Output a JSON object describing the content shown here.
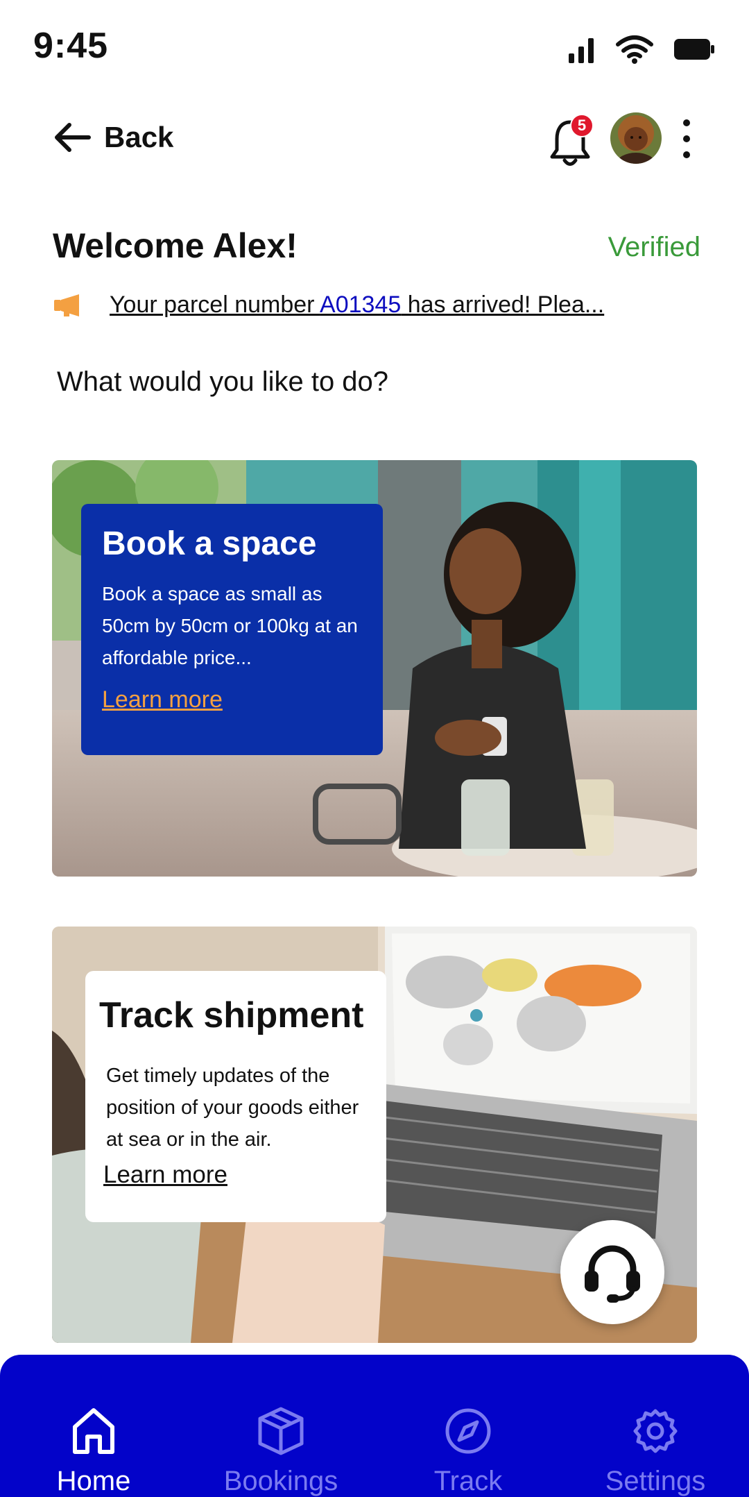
{
  "status_bar": {
    "time": "9:45"
  },
  "header": {
    "back_label": "Back",
    "notification_count": "5"
  },
  "welcome": {
    "greeting": "Welcome Alex!",
    "verified_label": "Verified"
  },
  "announcement": {
    "text_before": "Your parcel number ",
    "parcel_number": "A01345",
    "text_after": " has arrived! Plea..."
  },
  "prompt": "What would you like to do?",
  "cards": {
    "book": {
      "title": "Book a space",
      "description": "Book a space as small as 50cm by 50cm or 100kg at an affordable price...",
      "link": "Learn more"
    },
    "track": {
      "title": "Track shipment",
      "description": "Get timely updates of the position of your goods either at sea or in the air.",
      "link": "Learn more"
    }
  },
  "bottom_nav": {
    "items": [
      {
        "label": "Home",
        "icon": "home-icon",
        "active": true
      },
      {
        "label": "Bookings",
        "icon": "box-icon",
        "active": false
      },
      {
        "label": "Track",
        "icon": "compass-icon",
        "active": false
      },
      {
        "label": "Settings",
        "icon": "gear-icon",
        "active": false
      }
    ]
  },
  "colors": {
    "brand_blue": "#0303c9",
    "card_blue": "#0a2fa8",
    "accent_orange": "#f4a041",
    "verified_green": "#3a9a3a",
    "badge_red": "#e0182d"
  }
}
